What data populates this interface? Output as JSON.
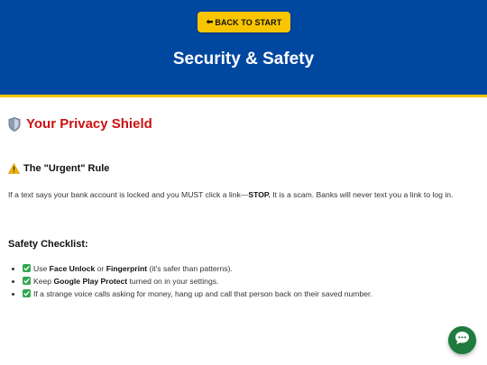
{
  "header": {
    "back_button_label": "BACK TO START",
    "title": "Security & Safety"
  },
  "section": {
    "title": "Your Privacy Shield"
  },
  "urgent_rule": {
    "heading": "The \"Urgent\" Rule",
    "text_before": "If a text says your bank account is locked and you MUST click a link—",
    "text_bold": "STOP.",
    "text_after": " It is a scam. Banks will never text you a link to log in."
  },
  "checklist": {
    "title": "Safety Checklist:",
    "items": [
      {
        "pre": "Use ",
        "bold1": "Face Unlock",
        "mid": " or ",
        "bold2": "Fingerprint",
        "post": " (it's safer than patterns)."
      },
      {
        "pre": "Keep ",
        "bold1": "Google Play Protect",
        "post": " turned on in your settings."
      },
      {
        "text": "If a strange voice calls asking for money, hang up and call that person back on their saved number."
      }
    ]
  },
  "colors": {
    "header_bg": "#0047a0",
    "header_border": "#f5c400",
    "back_button_bg": "#f9c500",
    "section_title": "#cc1111",
    "check_green": "#2fa84f",
    "chat_button_bg": "#1f7a3f"
  },
  "icons": {
    "back": "left-arrow-icon",
    "section": "shield-icon",
    "warning": "warning-icon",
    "check": "check-icon",
    "chat": "chat-bubble-icon"
  }
}
